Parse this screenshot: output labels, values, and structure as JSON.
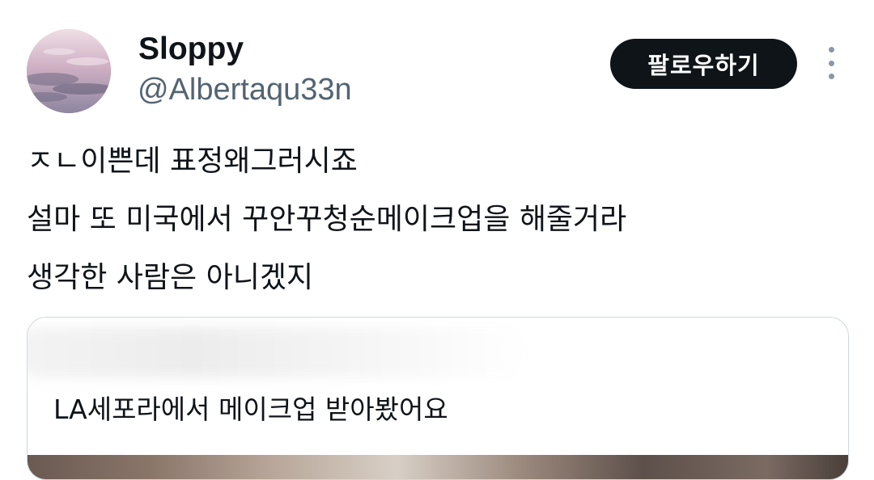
{
  "user": {
    "display_name": "Sloppy",
    "handle": "@Albertaqu33n",
    "avatar_icon": "avatar-sky-clouds"
  },
  "actions": {
    "follow_label": "팔로우하기",
    "more_icon": "more-vertical-icon"
  },
  "tweet": {
    "lines": [
      "ㅈㄴ이쁜데 표정왜그러시죠",
      "설마 또 미국에서 꾸안꾸청순메이크업을 해줄거라",
      "생각한 사람은 아니겠지"
    ]
  },
  "quote": {
    "text": "LA세포라에서 메이크업 받아봤어요"
  },
  "colors": {
    "text_primary": "#0f1419",
    "text_secondary": "#536471",
    "follow_button_bg": "#0f1419",
    "follow_button_text": "#ffffff",
    "border": "#cfd9de"
  }
}
